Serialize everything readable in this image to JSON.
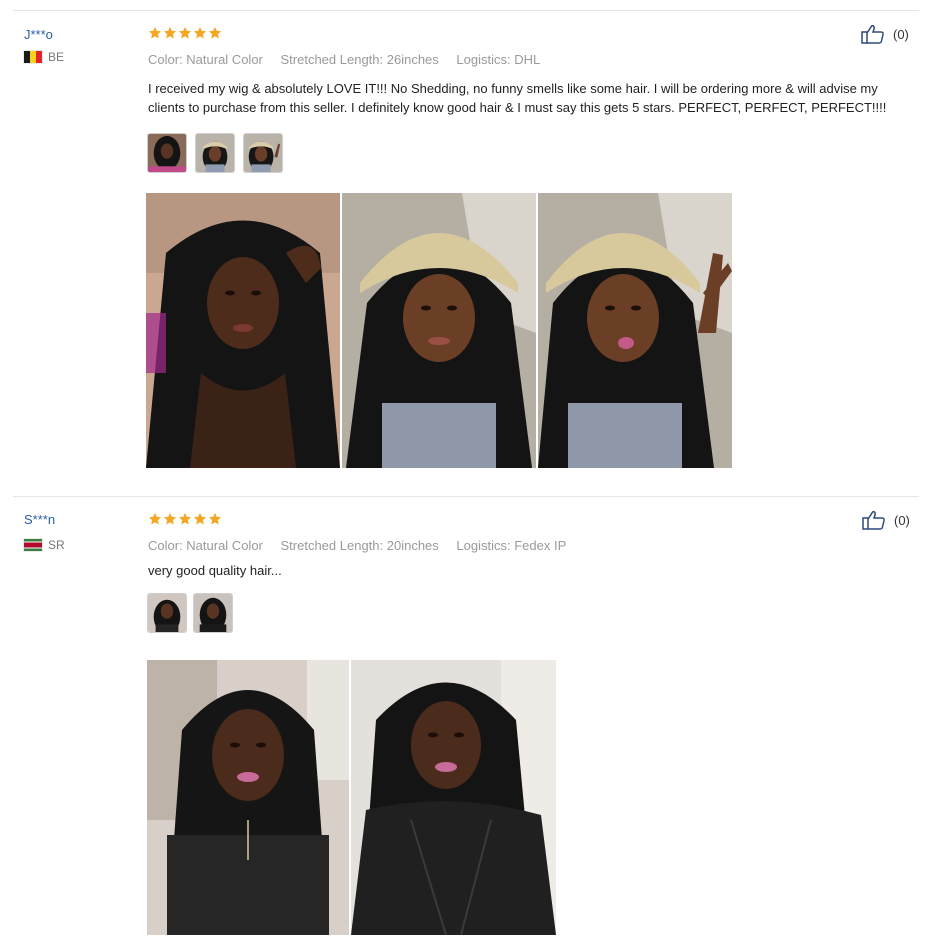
{
  "reviews": [
    {
      "user": "J***o",
      "country_code": "BE",
      "rating": 5,
      "attributes": {
        "color": "Color: Natural Color",
        "length": "Stretched Length: 26inches",
        "logistics": "Logistics: DHL"
      },
      "text": "I received my wig & absolutely LOVE IT!!! No Shedding, no funny smells like some hair. I will be ordering more & will advise my clients to purchase from this seller. I definitely know good hair & I must say this gets 5 stars. PERFECT, PERFECT, PERFECT!!!!",
      "helpful_count": "(0)",
      "thumbnail_count": 3,
      "photo_count": 3
    },
    {
      "user": "S***n",
      "country_code": "SR",
      "rating": 5,
      "attributes": {
        "color": "Color: Natural Color",
        "length": "Stretched Length: 20inches",
        "logistics": "Logistics: Fedex IP"
      },
      "text": "very good quality hair...",
      "helpful_count": "(0)",
      "thumbnail_count": 2,
      "photo_count": 2
    }
  ],
  "colors": {
    "star": "#f5a623",
    "username": "#2a5fa8",
    "meta": "#9a9a9a",
    "thumb_icon": "#2c4a7a"
  },
  "icons": {
    "rating": "star-icon",
    "helpful": "thumbs-up-icon",
    "be_flag": "belgium-flag-icon",
    "sr_flag": "suriname-flag-icon"
  }
}
